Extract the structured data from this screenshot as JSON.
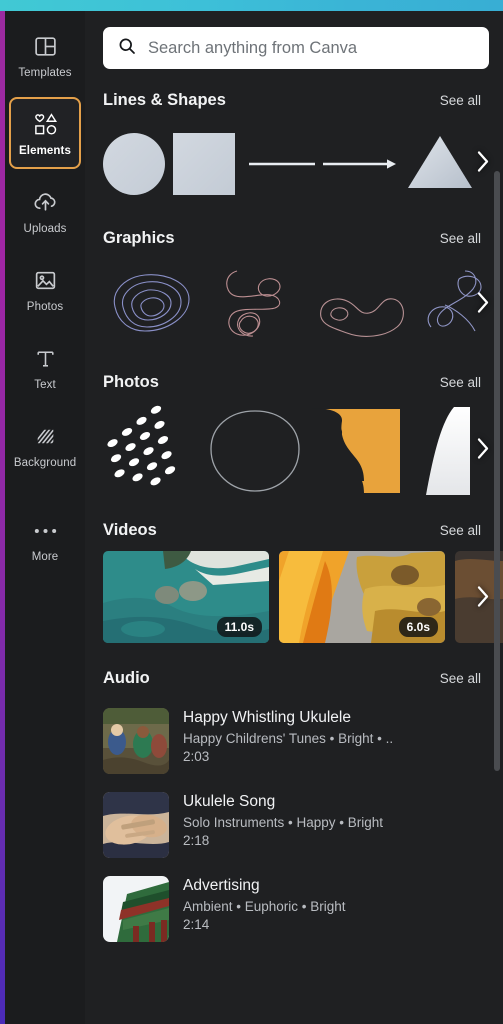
{
  "theme": {
    "top_bar_color": "#3dc4d8",
    "left_edge_color": "#9b2ba0",
    "panel_bg": "#1f2022",
    "rail_bg": "#1b1c1e",
    "active_outline": "#e4a04a",
    "accent_orange": "#e8a33c"
  },
  "sidebar": {
    "items": [
      {
        "label": "Templates",
        "icon": "templates-icon",
        "active": false
      },
      {
        "label": "Elements",
        "icon": "elements-icon",
        "active": true
      },
      {
        "label": "Uploads",
        "icon": "uploads-icon",
        "active": false
      },
      {
        "label": "Photos",
        "icon": "photos-icon",
        "active": false
      },
      {
        "label": "Text",
        "icon": "text-icon",
        "active": false
      },
      {
        "label": "Background",
        "icon": "background-icon",
        "active": false
      },
      {
        "label": "More",
        "icon": "more-icon",
        "active": false
      }
    ]
  },
  "search": {
    "placeholder": "Search anything from Canva",
    "value": "",
    "icon": "search-icon"
  },
  "sections": {
    "lines_shapes": {
      "title": "Lines & Shapes",
      "see_all": "See all",
      "items": [
        "circle",
        "square",
        "line",
        "arrow",
        "triangle"
      ]
    },
    "graphics": {
      "title": "Graphics",
      "see_all": "See all",
      "items": [
        "abstract-line-loops",
        "abstract-scribble",
        "abstract-wave",
        "abstract-curl"
      ]
    },
    "photos": {
      "title": "Photos",
      "see_all": "See all",
      "items": [
        "dot-pattern",
        "blob-outline",
        "orange-shape",
        "white-gradient"
      ]
    },
    "videos": {
      "title": "Videos",
      "see_all": "See all",
      "items": [
        {
          "name": "aerial-coastline",
          "duration": "11.0s"
        },
        {
          "name": "golden-flames",
          "duration": "6.0s"
        },
        {
          "name": "partial-clip",
          "duration": ""
        }
      ]
    },
    "audio": {
      "title": "Audio",
      "see_all": "See all",
      "tracks": [
        {
          "title": "Happy Whistling Ukulele",
          "tags": "Happy Childrens' Tunes • Bright • ..",
          "duration": "2:03",
          "thumb": "children-outdoors"
        },
        {
          "title": "Ukulele Song",
          "tags": "Solo Instruments • Happy • Bright",
          "duration": "2:18",
          "thumb": "hands-ukulele"
        },
        {
          "title": "Advertising",
          "tags": "Ambient • Euphoric • Bright",
          "duration": "2:14",
          "thumb": "green-temple"
        }
      ]
    }
  }
}
